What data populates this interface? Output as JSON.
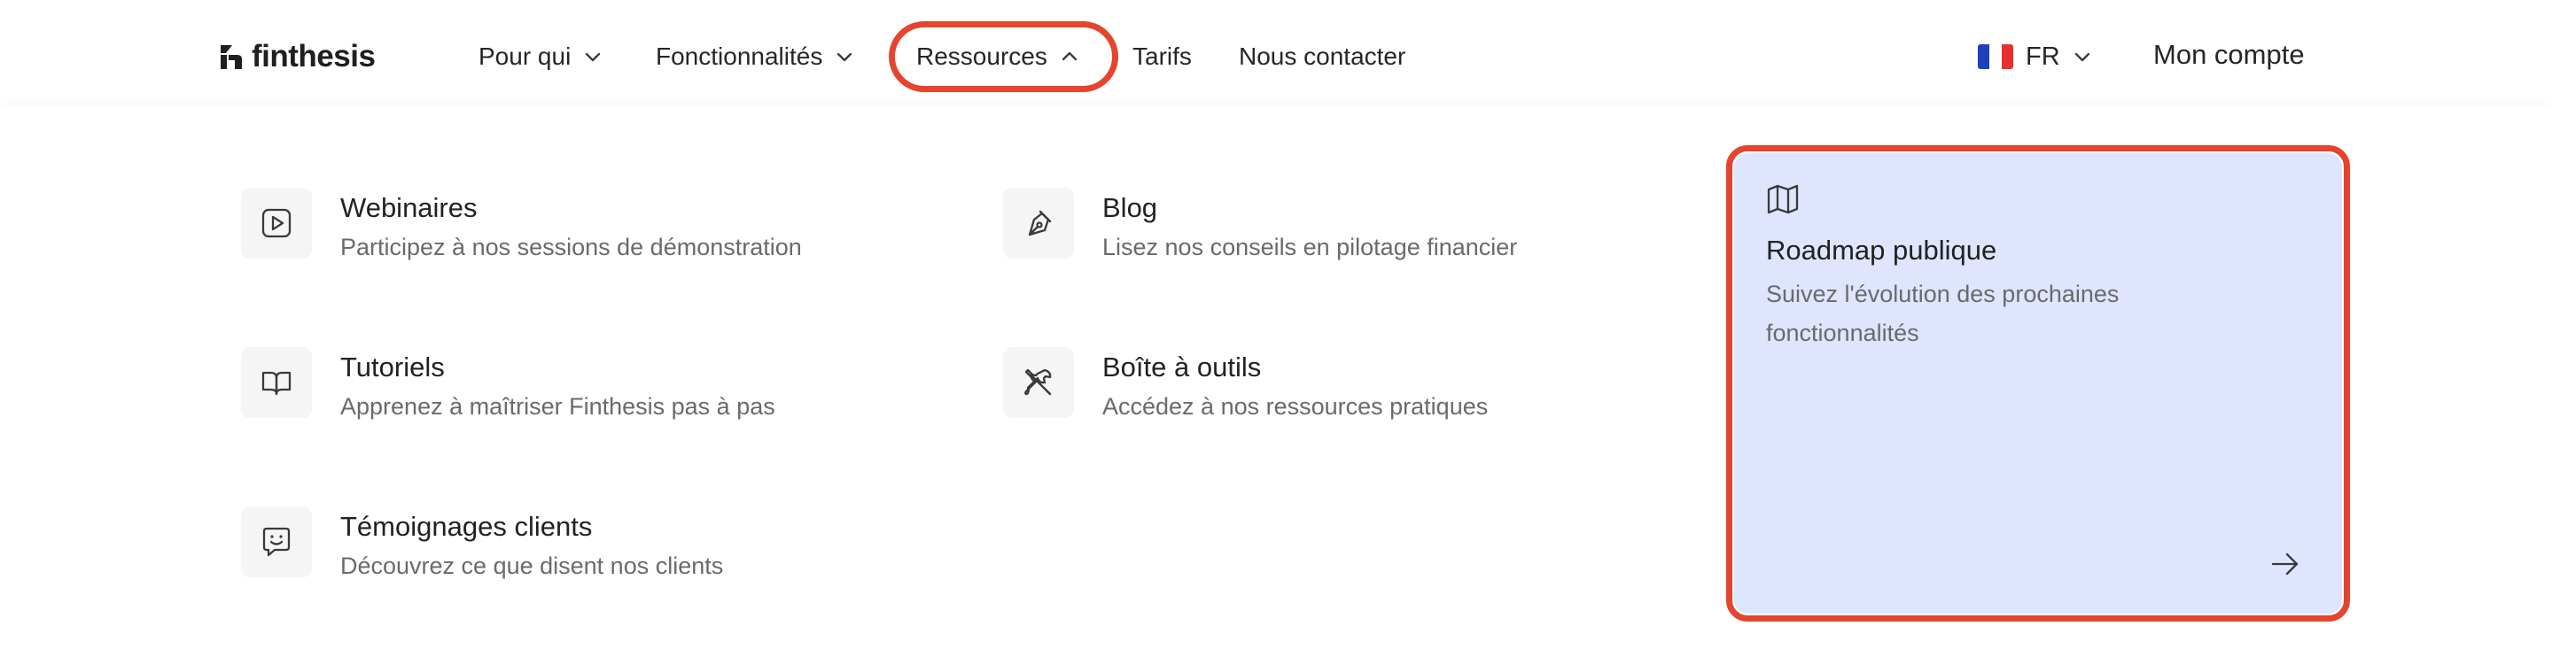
{
  "brand": {
    "name": "finthesis"
  },
  "nav": {
    "pour_qui": "Pour qui",
    "fonctionnalites": "Fonctionnalités",
    "ressources": "Ressources",
    "tarifs": "Tarifs",
    "contact": "Nous contacter"
  },
  "lang": {
    "code": "FR",
    "flag_colors": [
      "#1f3fbf",
      "#ffffff",
      "#e5302f"
    ]
  },
  "account": {
    "label": "Mon compte"
  },
  "resources": {
    "webinaires": {
      "title": "Webinaires",
      "desc": "Participez à nos sessions de démonstration",
      "icon": "play-icon"
    },
    "blog": {
      "title": "Blog",
      "desc": "Lisez nos conseils en pilotage financier",
      "icon": "pen-nib-icon"
    },
    "tutoriels": {
      "title": "Tutoriels",
      "desc": "Apprenez à maîtriser Finthesis pas à pas",
      "icon": "book-icon"
    },
    "boite": {
      "title": "Boîte à outils",
      "desc": "Accédez à nos ressources pratiques",
      "icon": "tools-icon"
    },
    "temoignages": {
      "title": "Témoignages clients",
      "desc": "Découvrez ce que disent nos clients",
      "icon": "smile-chat-icon"
    }
  },
  "roadmap": {
    "title": "Roadmap publique",
    "desc": "Suivez l'évolution des prochaines fonctionnalités",
    "icon": "map-icon",
    "arrow_icon": "arrow-right-icon"
  },
  "colors": {
    "highlight": "#e5442f",
    "card_bg": "#dfe5fd",
    "icon_bg": "#f5f5f5"
  }
}
